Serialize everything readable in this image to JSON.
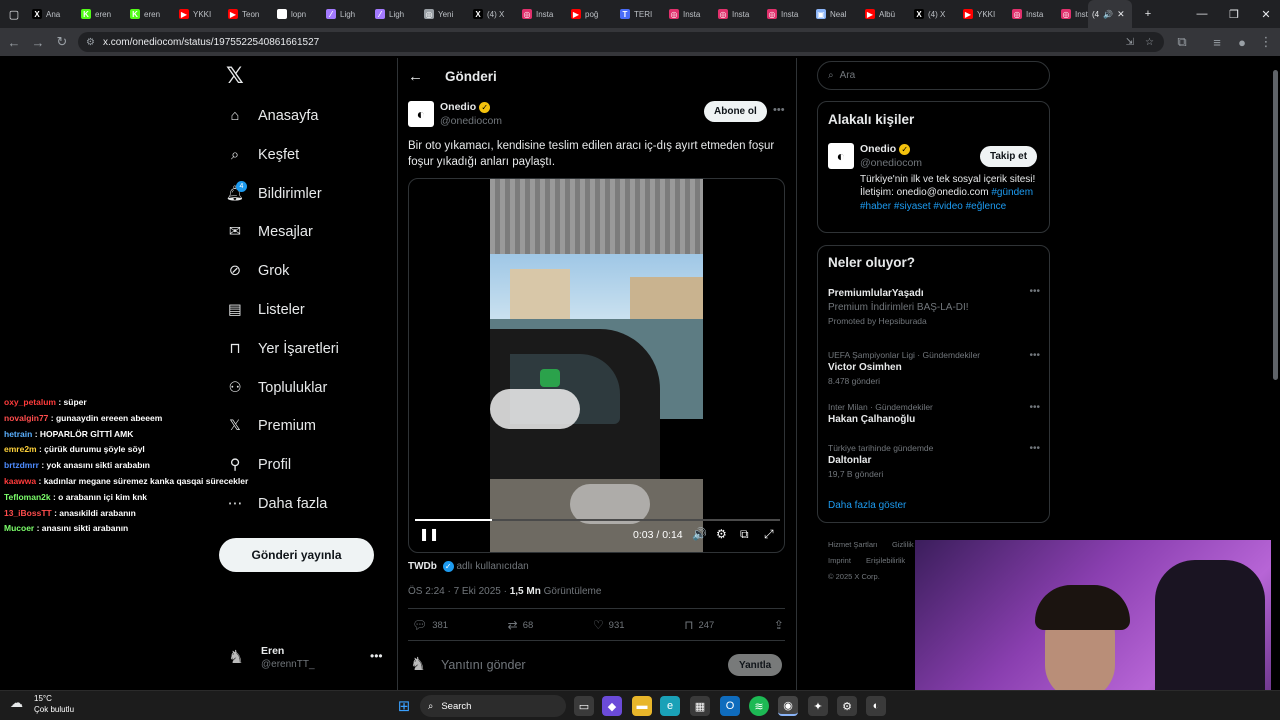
{
  "browser": {
    "tabs": [
      {
        "label": "Ana",
        "fav": "X",
        "color": "#000000"
      },
      {
        "label": "eren",
        "fav": "K",
        "color": "#53fc18"
      },
      {
        "label": "eren",
        "fav": "K",
        "color": "#53fc18"
      },
      {
        "label": "YKKI",
        "fav": "▶",
        "color": "#ff0000"
      },
      {
        "label": "Teon",
        "fav": "▶",
        "color": "#ff0000"
      },
      {
        "label": "lopn",
        "fav": "G",
        "color": "#ffffff"
      },
      {
        "label": "Ligh",
        "fav": "⁄",
        "color": "#a37aff"
      },
      {
        "label": "Ligh",
        "fav": "⁄",
        "color": "#a37aff"
      },
      {
        "label": "Yeni",
        "fav": "◎",
        "color": "#9aa0a6"
      },
      {
        "label": "(4) X",
        "fav": "X",
        "color": "#000000"
      },
      {
        "label": "Insta",
        "fav": "◎",
        "color": "#e1306c"
      },
      {
        "label": "poğ",
        "fav": "▶",
        "color": "#ff0000"
      },
      {
        "label": "TERI",
        "fav": "T",
        "color": "#4a6cf7"
      },
      {
        "label": "Insta",
        "fav": "◎",
        "color": "#e1306c"
      },
      {
        "label": "Insta",
        "fav": "◎",
        "color": "#e1306c"
      },
      {
        "label": "Insta",
        "fav": "◎",
        "color": "#e1306c"
      },
      {
        "label": "Neal",
        "fav": "▣",
        "color": "#8ab4f8"
      },
      {
        "label": "Albü",
        "fav": "▶",
        "color": "#ff0000"
      },
      {
        "label": "(4) X",
        "fav": "X",
        "color": "#000000"
      },
      {
        "label": "YKKI",
        "fav": "▶",
        "color": "#ff0000"
      },
      {
        "label": "Insta",
        "fav": "◎",
        "color": "#e1306c"
      },
      {
        "label": "Insta",
        "fav": "◎",
        "color": "#e1306c"
      }
    ],
    "active_tab": {
      "label": "(4"
    },
    "url": "x.com/onediocom/status/1975522540861661527"
  },
  "nav": {
    "items": [
      {
        "label": "Anasayfa",
        "icon": "home-icon"
      },
      {
        "label": "Keşfet",
        "icon": "search-icon"
      },
      {
        "label": "Bildirimler",
        "icon": "bell-icon",
        "badge": "4"
      },
      {
        "label": "Mesajlar",
        "icon": "mail-icon"
      },
      {
        "label": "Grok",
        "icon": "grok-icon"
      },
      {
        "label": "Listeler",
        "icon": "list-icon"
      },
      {
        "label": "Yer İşaretleri",
        "icon": "bookmark-icon"
      },
      {
        "label": "Topluluklar",
        "icon": "people-icon"
      },
      {
        "label": "Premium",
        "icon": "x-icon"
      },
      {
        "label": "Profil",
        "icon": "person-icon"
      },
      {
        "label": "Daha fazla",
        "icon": "more-circle-icon"
      }
    ],
    "post_button": "Gönderi yayınla",
    "user": {
      "name": "Eren",
      "handle": "@erennTT_"
    }
  },
  "post": {
    "header_title": "Gönderi",
    "author": {
      "name": "Onedio",
      "handle": "@onediocom"
    },
    "subscribe_label": "Abone ol",
    "text": "Bir oto yıkamacı, kendisine teslim edilen aracı iç-dış ayırt etmeden foşur foşur yıkadığı anları paylaştı.",
    "video_time": "0:03 / 0:14",
    "video_progress": 0.21,
    "source_user": "TWDb",
    "source_suffix": "adlı kullanıcıdan",
    "timestamp": "ÖS 2:24 · 7 Eki 2025 · ",
    "views": "1,5 Mn",
    "views_label": "Görüntüleme",
    "counts": {
      "replies": "381",
      "reposts": "68",
      "likes": "931",
      "bookmarks": "247"
    },
    "reply_placeholder": "Yanıtını gönder",
    "reply_button": "Yanıtla"
  },
  "right": {
    "search_placeholder": "Ara",
    "related_title": "Alakalı kişiler",
    "related": {
      "name": "Onedio",
      "handle": "@onediocom",
      "follow": "Takip et",
      "bio": "Türkiye'nin ilk ve tek sosyal içerik sitesi! İletişim: onedio@onedio.com",
      "tags": "#gündem #haber #siyaset #video #eğlence"
    },
    "trends_title": "Neler oluyor?",
    "trends": [
      {
        "meta": "",
        "title": "PremiumlularYaşadı",
        "sub": "Premium İndirimleri BAŞ-LA-DI!",
        "extra": "Promoted by Hepsiburada"
      },
      {
        "meta": "UEFA Şampiyonlar Ligi · Gündemdekiler",
        "title": "Victor Osimhen",
        "sub": "8.478 gönderi",
        "extra": ""
      },
      {
        "meta": "Inter Milan · Gündemdekiler",
        "title": "Hakan Çalhanoğlu",
        "sub": "",
        "extra": ""
      },
      {
        "meta": "Türkiye tarihinde gündemde",
        "title": "Daltonlar",
        "sub": "19,7 B gönderi",
        "extra": ""
      }
    ],
    "show_more": "Daha fazla göster",
    "footer": [
      "Hizmet Şartları",
      "Gizlilik",
      "Imprint",
      "Erişilebilirlik",
      "© 2025 X Corp."
    ]
  },
  "chat": [
    {
      "user": "oxy_petalum",
      "msg": "süper",
      "color": "#ff3b3b"
    },
    {
      "user": "novalgin77",
      "msg": "gunaaydin ereeen abeeem",
      "color": "#ff4d4d"
    },
    {
      "user": "hetrain",
      "msg": "HOPARLÖR GİTTİ AMK",
      "color": "#5ab0ff"
    },
    {
      "user": "emre2m",
      "msg": "çürük durumu şöyle söyl",
      "color": "#ffd23a"
    },
    {
      "user": "brtzdmrr",
      "msg": "yok anasını sikti arababın",
      "color": "#4e8cff"
    },
    {
      "user": "kaawwa",
      "msg": "kadınlar megane süremez kanka qasqai sürecekler",
      "color": "#ff3b3b"
    },
    {
      "user": "Tefloman2k",
      "msg": "o arabanın içi kim knk",
      "color": "#7cff6b"
    },
    {
      "user": "13_iBossTT",
      "msg": "anasıkildi arabanın",
      "color": "#ff4d4d"
    },
    {
      "user": "Mucoer",
      "msg": "anasını sikti arabanın",
      "color": "#7cff6b"
    }
  ],
  "taskbar": {
    "weather_temp": "15°C",
    "weather_desc": "Çok bulutlu",
    "search_label": "Search"
  }
}
